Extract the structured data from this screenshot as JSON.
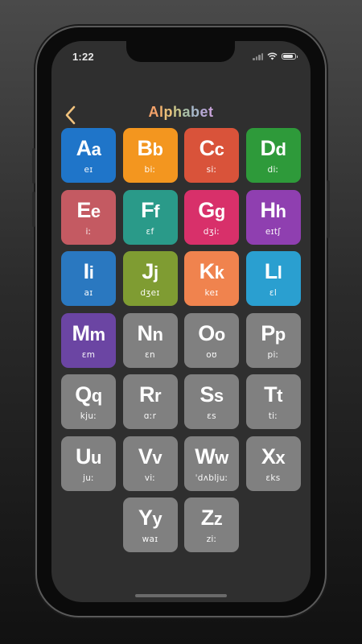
{
  "status_bar": {
    "time": "1:22",
    "battery_level": 0.85
  },
  "header": {
    "back_icon": "chevron-left-icon",
    "title_letters": [
      {
        "ch": "A",
        "color": "#f4a36a"
      },
      {
        "ch": "l",
        "color": "#f1b26e"
      },
      {
        "ch": "p",
        "color": "#e9c07a"
      },
      {
        "ch": "h",
        "color": "#c9c58a"
      },
      {
        "ch": "a",
        "color": "#a9bfa8"
      },
      {
        "ch": "b",
        "color": "#a6b7c9"
      },
      {
        "ch": "e",
        "color": "#b7a9d6"
      },
      {
        "ch": "t",
        "color": "#c7a3d9"
      }
    ]
  },
  "letters": [
    {
      "upper": "A",
      "lower": "a",
      "ipa": "eɪ",
      "color": "#1f75c9"
    },
    {
      "upper": "B",
      "lower": "b",
      "ipa": "biː",
      "color": "#f3961f"
    },
    {
      "upper": "C",
      "lower": "c",
      "ipa": "siː",
      "color": "#d9533a"
    },
    {
      "upper": "D",
      "lower": "d",
      "ipa": "diː",
      "color": "#2e9a3a"
    },
    {
      "upper": "E",
      "lower": "e",
      "ipa": "iː",
      "color": "#c45a62"
    },
    {
      "upper": "F",
      "lower": "f",
      "ipa": "ɛf",
      "color": "#2a9a89"
    },
    {
      "upper": "G",
      "lower": "g",
      "ipa": "dʒiː",
      "color": "#d8306a"
    },
    {
      "upper": "H",
      "lower": "h",
      "ipa": "eɪtʃ",
      "color": "#8f3fb0"
    },
    {
      "upper": "I",
      "lower": "i",
      "ipa": "aɪ",
      "color": "#2a78c0"
    },
    {
      "upper": "J",
      "lower": "j",
      "ipa": "dʒeɪ",
      "color": "#7f9c32"
    },
    {
      "upper": "K",
      "lower": "k",
      "ipa": "keɪ",
      "color": "#f0834e"
    },
    {
      "upper": "L",
      "lower": "l",
      "ipa": "ɛl",
      "color": "#2a9fd0"
    },
    {
      "upper": "M",
      "lower": "m",
      "ipa": "ɛm",
      "color": "#6b45a3"
    },
    {
      "upper": "N",
      "lower": "n",
      "ipa": "ɛn",
      "color": "#808080"
    },
    {
      "upper": "O",
      "lower": "o",
      "ipa": "oʊ",
      "color": "#808080"
    },
    {
      "upper": "P",
      "lower": "p",
      "ipa": "piː",
      "color": "#808080"
    },
    {
      "upper": "Q",
      "lower": "q",
      "ipa": "kjuː",
      "color": "#808080"
    },
    {
      "upper": "R",
      "lower": "r",
      "ipa": "ɑːr",
      "color": "#808080"
    },
    {
      "upper": "S",
      "lower": "s",
      "ipa": "ɛs",
      "color": "#808080"
    },
    {
      "upper": "T",
      "lower": "t",
      "ipa": "tiː",
      "color": "#808080"
    },
    {
      "upper": "U",
      "lower": "u",
      "ipa": "juː",
      "color": "#808080"
    },
    {
      "upper": "V",
      "lower": "v",
      "ipa": "viː",
      "color": "#808080"
    },
    {
      "upper": "W",
      "lower": "w",
      "ipa": "ˈdʌbljuː",
      "color": "#808080"
    },
    {
      "upper": "X",
      "lower": "x",
      "ipa": "ɛks",
      "color": "#808080"
    },
    {
      "upper": "Y",
      "lower": "y",
      "ipa": "waɪ",
      "color": "#808080"
    },
    {
      "upper": "Z",
      "lower": "z",
      "ipa": "ziː",
      "color": "#808080"
    }
  ]
}
